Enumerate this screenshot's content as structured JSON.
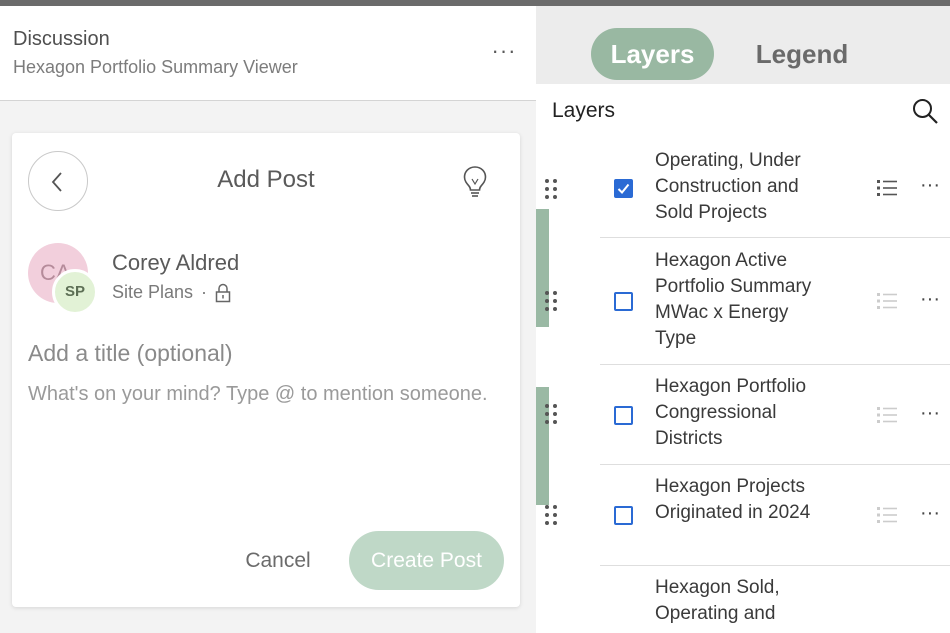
{
  "discussion": {
    "title": "Discussion",
    "subtitle": "Hexagon Portfolio Summary Viewer",
    "more_icon": "ellipsis-icon"
  },
  "add_post": {
    "title": "Add Post",
    "back_icon": "chevron-left-icon",
    "tip_icon": "lightbulb-icon",
    "author": {
      "name": "Corey Aldred",
      "avatar_initials": "CA",
      "group_initials": "SP",
      "group_name": "Site Plans",
      "separator": "·",
      "lock_icon": "lock-icon"
    },
    "title_placeholder": "Add a title (optional)",
    "body_placeholder": "What's on your mind? Type @ to mention someone.",
    "cancel_label": "Cancel",
    "create_label": "Create Post"
  },
  "panel": {
    "tabs": [
      {
        "label": "Layers",
        "active": true
      },
      {
        "label": "Legend",
        "active": false
      }
    ],
    "heading": "Layers",
    "search_icon": "search-icon"
  },
  "layers": [
    {
      "label": "Operating, Under Construction and Sold Projects",
      "checked": true
    },
    {
      "label": "Hexagon Active Portfolio Summary MWac x Energy Type",
      "checked": false
    },
    {
      "label": "Hexagon Portfolio Congressional Districts",
      "checked": false
    },
    {
      "label": "Hexagon Projects Originated in 2024",
      "checked": false
    },
    {
      "label": "Hexagon Sold, Operating and",
      "checked": null
    }
  ],
  "colors": {
    "accent_green": "#99b8a2",
    "button_disabled": "#bfd8c7",
    "checkbox_blue": "#2a6ad4",
    "avatar_pink": "#f2cfdc",
    "group_avatar_green": "#e2f2d6"
  }
}
